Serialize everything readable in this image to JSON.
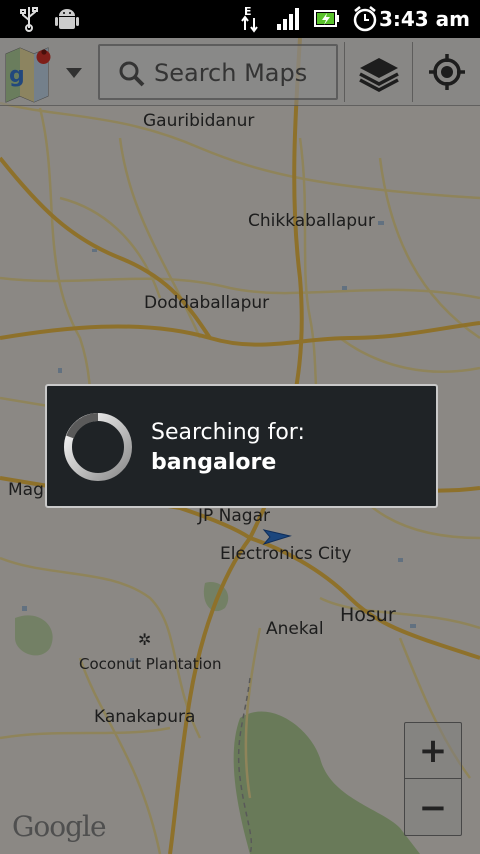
{
  "status_bar": {
    "time": "3:43 am",
    "icons": [
      "usb-icon",
      "android-debug-icon",
      "network-e-icon",
      "signal-icon",
      "battery-charging-icon",
      "alarm-icon"
    ],
    "network_type": "E"
  },
  "toolbar": {
    "search_placeholder": "Search Maps",
    "maps_logo_icon": "google-maps-logo-icon",
    "layers_icon": "layers-icon",
    "locate_icon": "my-location-icon"
  },
  "map": {
    "places": [
      {
        "name": "Gauribidanur"
      },
      {
        "name": "Chikkaballapur"
      },
      {
        "name": "Doddaballapur"
      },
      {
        "name": "Magadi"
      },
      {
        "name": "JP Nagar"
      },
      {
        "name": "Electronics City"
      },
      {
        "name": "Hosur"
      },
      {
        "name": "Anekal"
      },
      {
        "name": "Coconut Plantation"
      },
      {
        "name": "Kanakapura"
      }
    ],
    "attribution": "Google"
  },
  "zoom": {
    "in_label": "+",
    "out_label": "−"
  },
  "dialog": {
    "line1": "Searching for:",
    "line2": "bangalore"
  },
  "colors": {
    "map_bg": "#efebe3",
    "highway": "#f5c34a",
    "road": "#f7e39c",
    "park": "#b6d39a",
    "dialog_bg": "#1f2326",
    "location_arrow": "#2f79d8"
  }
}
